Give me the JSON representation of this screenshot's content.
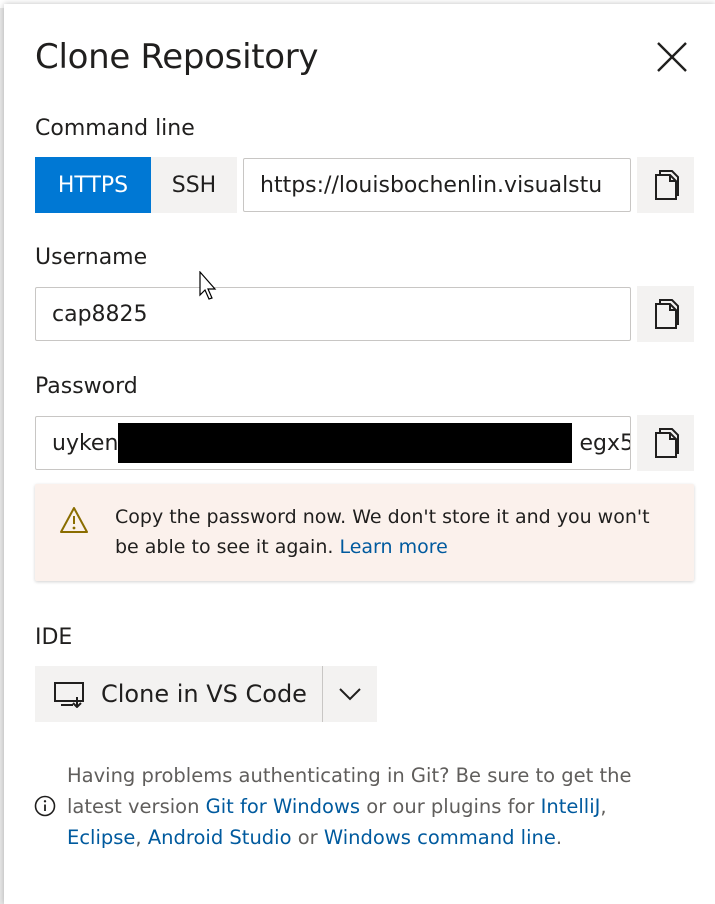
{
  "dialog": {
    "title": "Clone Repository",
    "close_icon": "close-icon"
  },
  "command_line": {
    "label": "Command line",
    "protocols": [
      "HTTPS",
      "SSH"
    ],
    "selected_protocol": "HTTPS",
    "url": "https://louisbochenlin.visualstu",
    "copy_icon": "copy-icon"
  },
  "username": {
    "label": "Username",
    "value": "cap8825"
  },
  "password": {
    "label": "Password",
    "value_start": "uyken",
    "value_end": "egx5",
    "redacted": true
  },
  "warning": {
    "icon": "warning-icon",
    "text": "Copy the password now. We don't store it and you won't be able to see it again.",
    "link": "Learn more"
  },
  "ide": {
    "label": "IDE",
    "clone_button": "Clone in VS Code",
    "clone_icon": "monitor-icon",
    "dropdown_icon": "chevron-down-icon"
  },
  "help": {
    "icon": "info-icon",
    "text_1": "Having problems authenticating in Git? Be sure to get the latest version",
    "link_git": "Git for Windows",
    "text_2": "or our plugins for",
    "link_intellij": "IntelliJ",
    "link_eclipse": "Eclipse",
    "link_android": "Android Studio",
    "text_3": "or",
    "link_cmd": "Windows command line"
  },
  "colors": {
    "accent": "#0078d4",
    "link": "#005a9e",
    "warning_bg": "#fbf1ec"
  }
}
